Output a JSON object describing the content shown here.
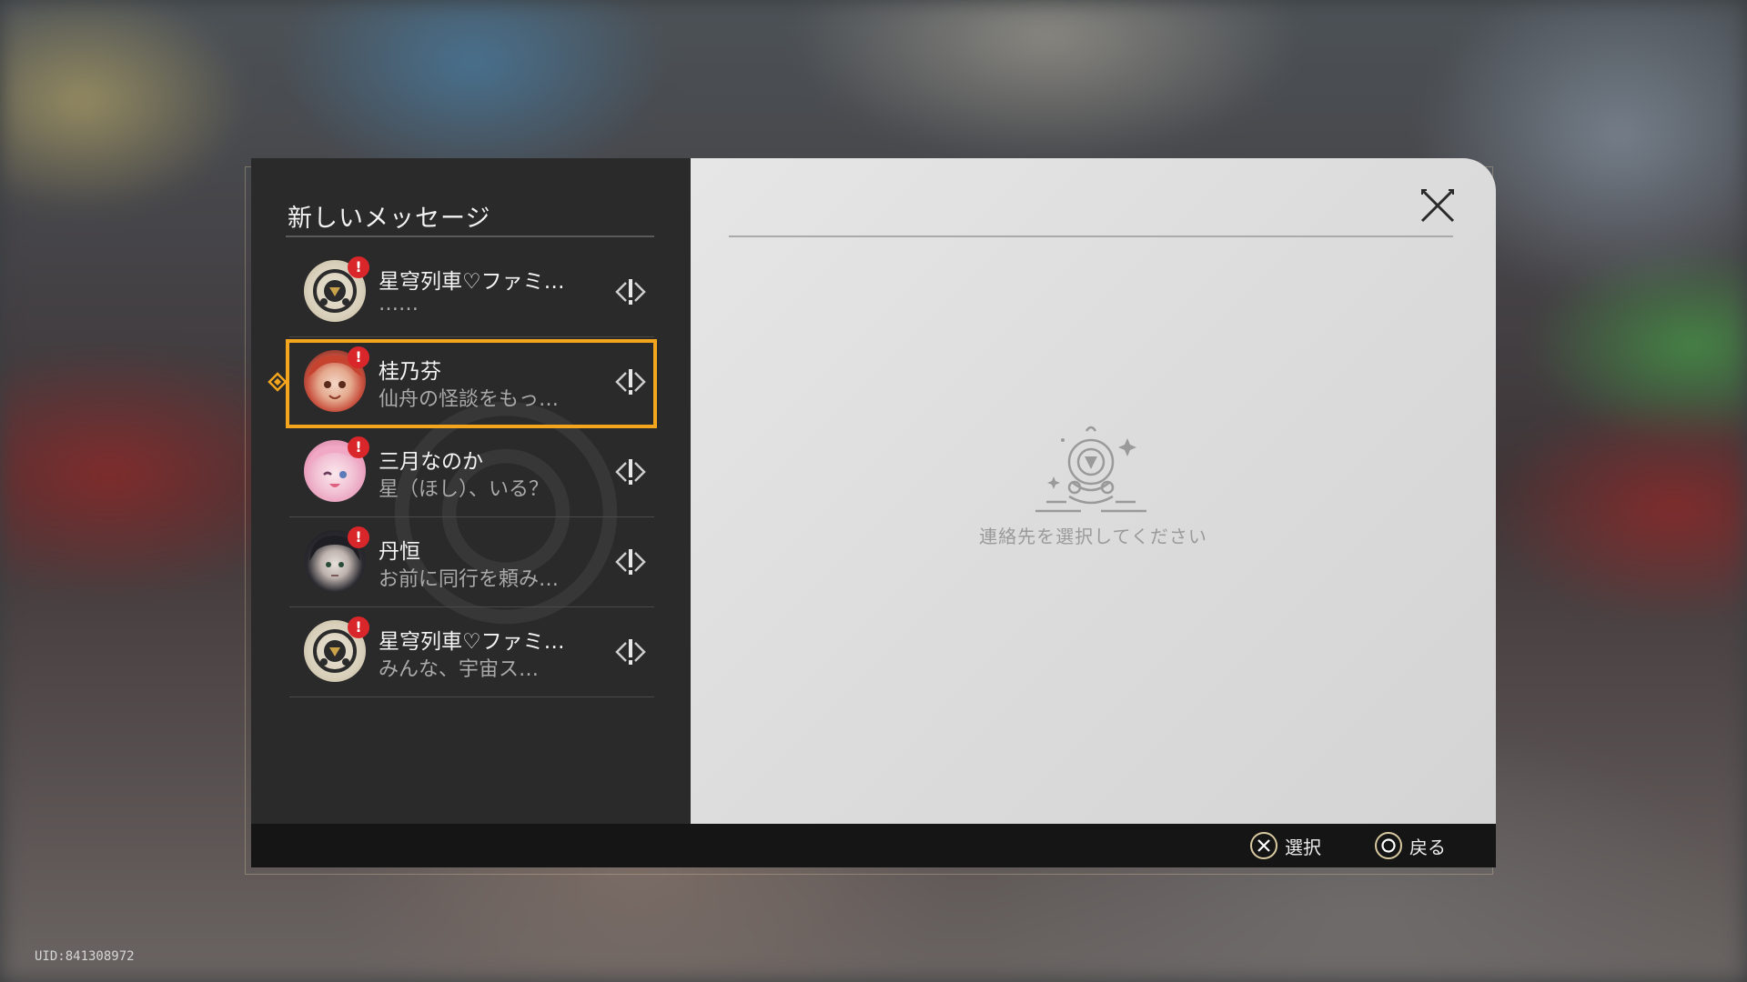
{
  "panel": {
    "title": "新しいメッセージ",
    "placeholder_text": "連絡先を選択してください"
  },
  "conversations": [
    {
      "name": "星穹列車♡ファミ…",
      "preview": "……",
      "avatar": "train-emblem-avatar",
      "unread": "!"
    },
    {
      "name": "桂乃芬",
      "preview": "仙舟の怪談をもっ…",
      "avatar": "guinaifen-avatar",
      "unread": "!",
      "selected": true
    },
    {
      "name": "三月なのか",
      "preview": "星（ほし）、いる？",
      "avatar": "march7th-avatar",
      "unread": "!"
    },
    {
      "name": "丹恒",
      "preview": "お前に同行を頼み…",
      "avatar": "danheng-avatar",
      "unread": "!"
    },
    {
      "name": "星穹列車♡ファミ…",
      "preview": "みんな、宇宙ス…",
      "avatar": "train-emblem-avatar",
      "unread": "!"
    }
  ],
  "bottom_hints": [
    {
      "button": "cross-button-icon",
      "label": "選択"
    },
    {
      "button": "circle-button-icon",
      "label": "戻る"
    }
  ],
  "uid": "UID:841308972",
  "colors": {
    "selection": "#f2a51d",
    "badge": "#d8262a",
    "left_panel": "#2a2a2b",
    "right_panel": "#dcdcdc"
  }
}
